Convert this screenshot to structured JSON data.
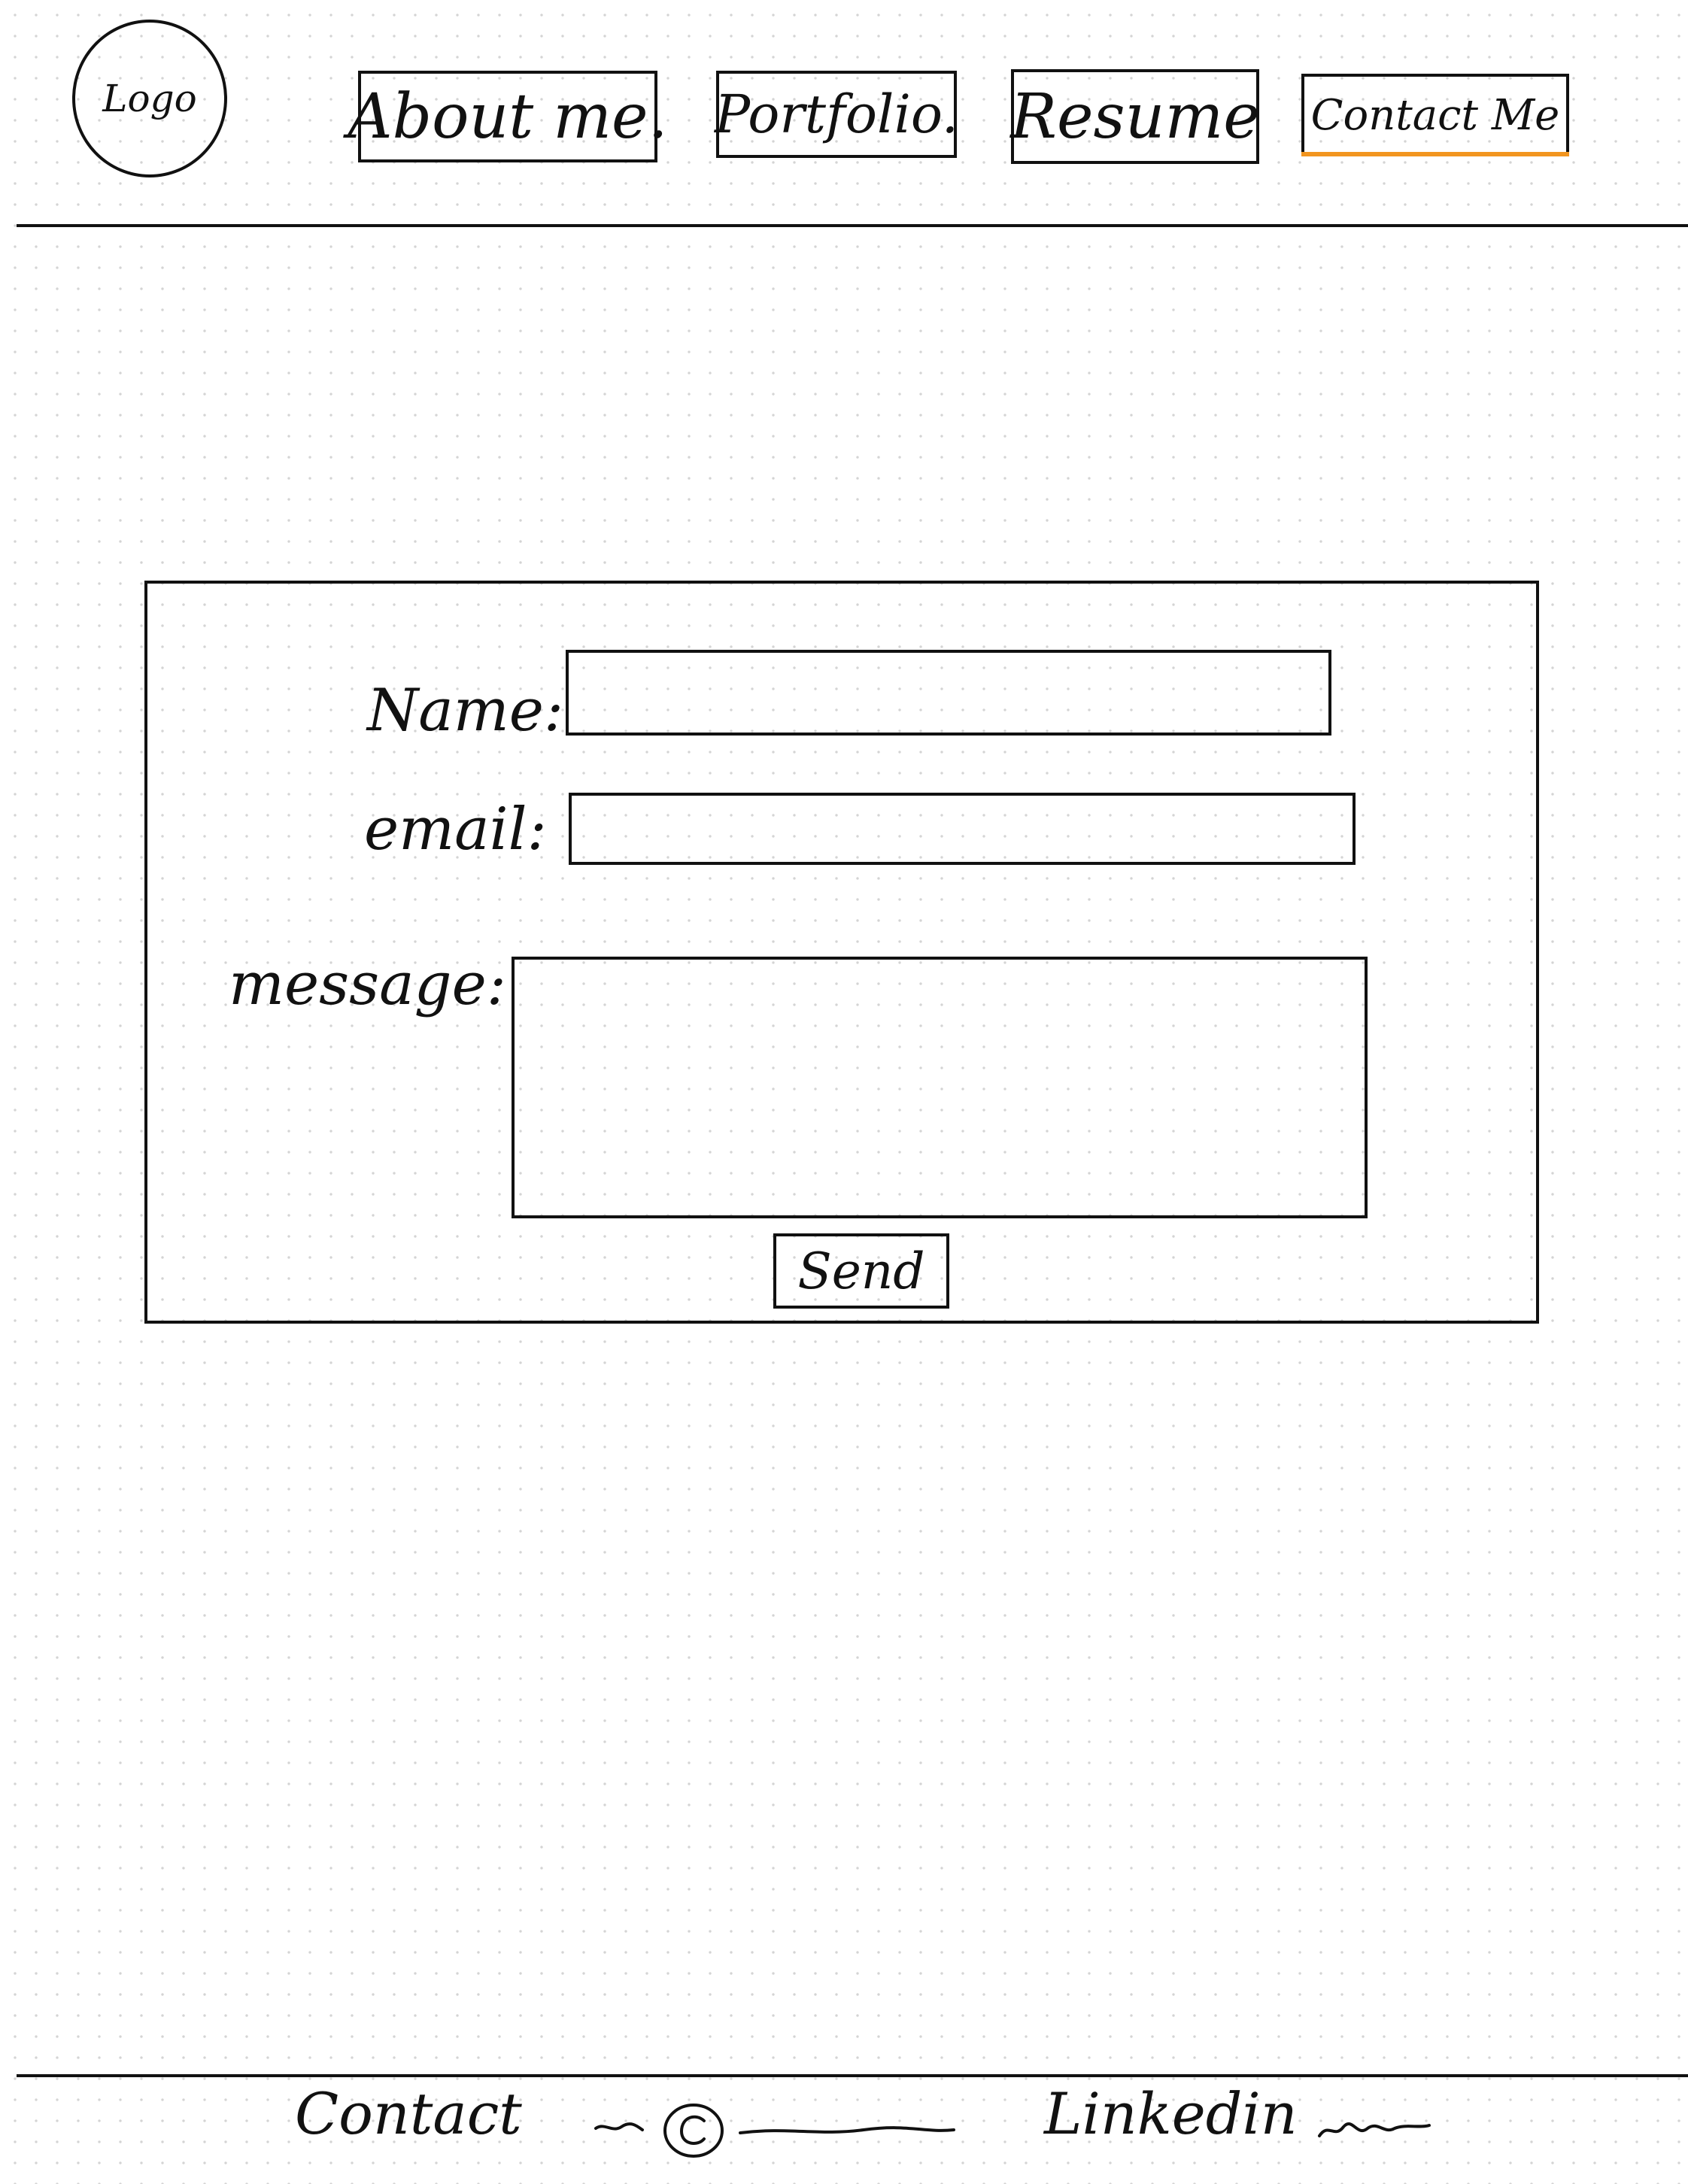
{
  "header": {
    "logo_text": "Logo",
    "nav": {
      "about": "About me.",
      "portfolio": "Portfolio.",
      "resume": "Resume",
      "contact": "Contact Me"
    },
    "active_nav": "contact",
    "accent_color": "#f2951f"
  },
  "form": {
    "name_label": "Name:",
    "email_label": "email:",
    "message_label": "message:",
    "name_value": "",
    "email_value": "",
    "message_value": "",
    "send_label": "Send"
  },
  "footer": {
    "contact_label": "Contact",
    "copyright_icon": "copyright-icon",
    "linkedin_label": "Linkedin"
  },
  "colors": {
    "ink": "#111111",
    "background": "#ffffff",
    "grid_dot": "#d4d4d4"
  }
}
